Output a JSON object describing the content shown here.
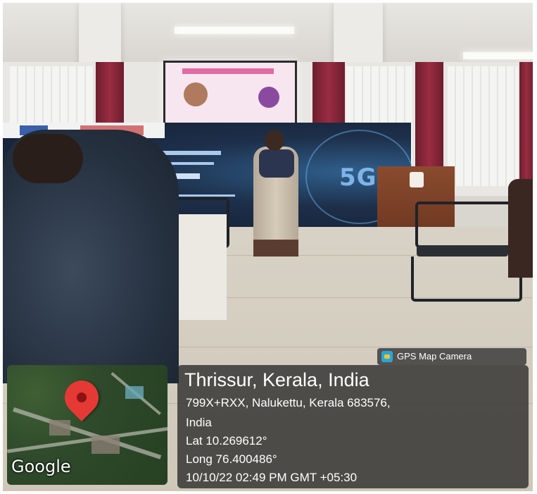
{
  "overlay": {
    "badge_label": "GPS Map Camera",
    "map_brand": "Google",
    "location_title": "Thrissur, Kerala, India",
    "address_line1": "799X+RXX, Nalukettu, Kerala 683576,",
    "address_line2": "India",
    "latitude": "Lat 10.269612°",
    "longitude": "Long 76.400486°",
    "datetime": "10/10/22 02:49 PM GMT +05:30"
  },
  "icons": {
    "badge": "camera-app-icon",
    "pin": "location-pin-icon"
  },
  "colors": {
    "pin": "#e53935",
    "info_panel": "#282828",
    "banner": "#1d2f4a"
  }
}
